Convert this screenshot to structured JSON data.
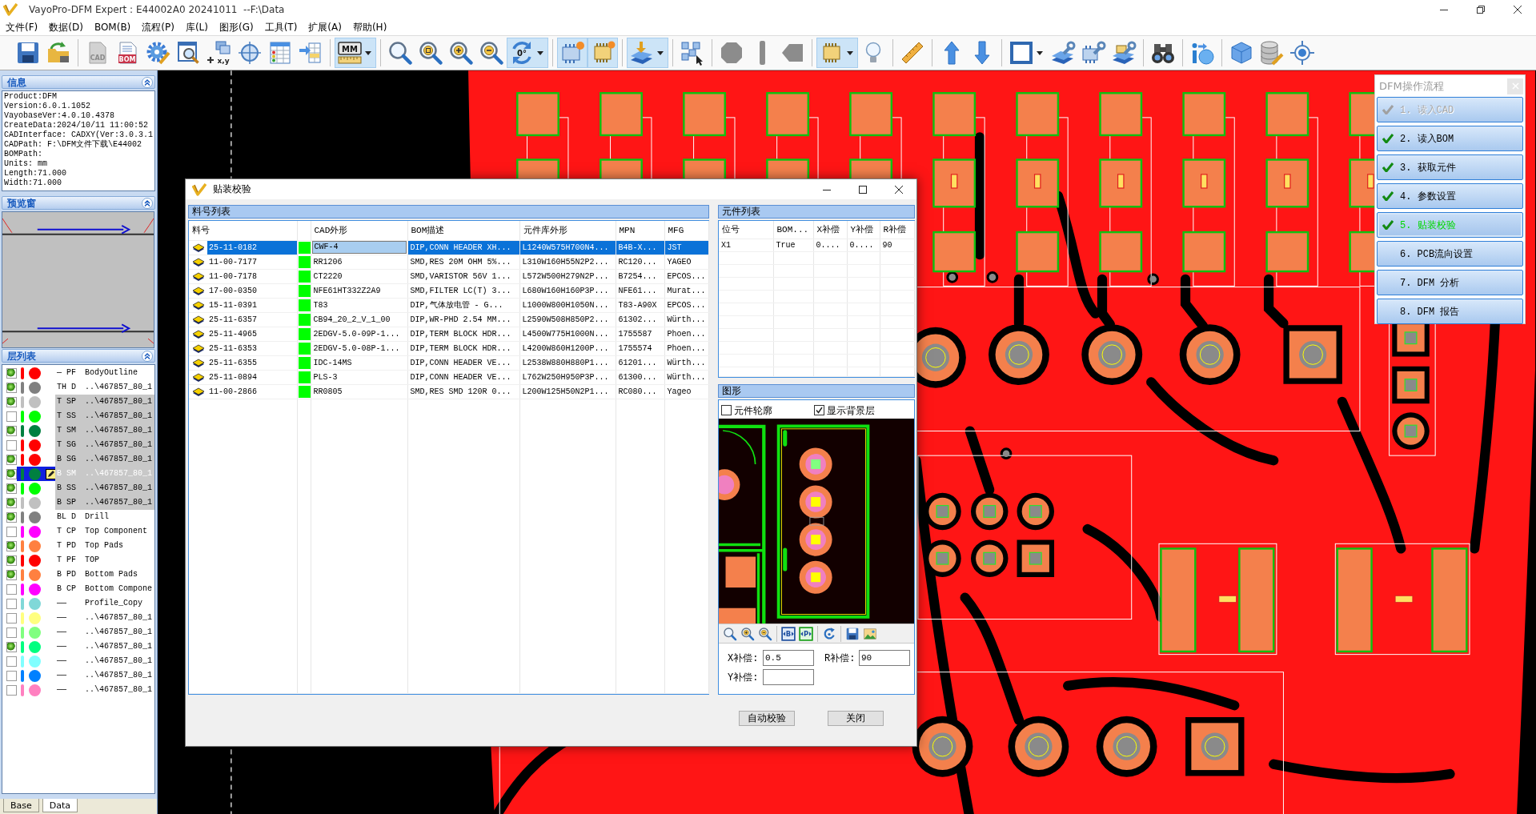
{
  "window": {
    "title": "VayoPro-DFM Expert : E44002A0 20241011  --F:\\Data"
  },
  "menu": [
    "文件(F)",
    "数据(D)",
    "BOM(B)",
    "流程(P)",
    "库(L)",
    "图形(G)",
    "工具(T)",
    "扩展(A)",
    "帮助(H)"
  ],
  "toolbar": [
    [
      {
        "kind": "save",
        "pressed": false
      },
      {
        "kind": "reload",
        "pressed": false
      }
    ],
    [
      {
        "kind": "cad",
        "label": "CAD",
        "pressed": false
      },
      {
        "kind": "bom",
        "label": "BOM",
        "pressed": false
      },
      {
        "kind": "gear",
        "pressed": false
      },
      {
        "kind": "find",
        "pressed": false
      },
      {
        "kind": "xy",
        "label": "x,y",
        "pressed": false
      },
      {
        "kind": "target",
        "pressed": false
      },
      {
        "kind": "table",
        "pressed": false
      },
      {
        "kind": "import",
        "pressed": false
      }
    ],
    [
      {
        "kind": "units",
        "label": "MM",
        "pressed": true,
        "dropdown": true
      }
    ],
    [
      {
        "kind": "zoom",
        "pressed": false
      },
      {
        "kind": "zoom-fit",
        "pressed": false
      },
      {
        "kind": "zoom-in",
        "pressed": false
      },
      {
        "kind": "zoom-out",
        "pressed": false
      },
      {
        "kind": "rotate",
        "label": "0°",
        "pressed": true,
        "dropdown": true
      }
    ],
    [
      {
        "kind": "component",
        "pressed": true
      },
      {
        "kind": "component-alt",
        "pressed": true
      }
    ],
    [
      {
        "kind": "layers",
        "pressed": true,
        "dropdown": true
      }
    ],
    [
      {
        "kind": "select",
        "pressed": false
      }
    ],
    [
      {
        "kind": "octagon",
        "pressed": false
      },
      {
        "kind": "bar",
        "pressed": false
      },
      {
        "kind": "notch",
        "pressed": false
      }
    ],
    [
      {
        "kind": "chip",
        "pressed": true,
        "dropdown": true
      },
      {
        "kind": "bulb",
        "pressed": false
      }
    ],
    [
      {
        "kind": "ruler",
        "pressed": false
      }
    ],
    [
      {
        "kind": "up",
        "pressed": false
      },
      {
        "kind": "down",
        "pressed": false
      }
    ],
    [
      {
        "kind": "square",
        "pressed": false,
        "dropdown": true
      },
      {
        "kind": "tool-layers",
        "pressed": false
      },
      {
        "kind": "tool-chip",
        "pressed": false
      },
      {
        "kind": "tool-both",
        "pressed": false
      }
    ],
    [
      {
        "kind": "binoculars",
        "pressed": false
      }
    ],
    [
      {
        "kind": "info",
        "pressed": false
      }
    ],
    [
      {
        "kind": "box",
        "pressed": false
      },
      {
        "kind": "database",
        "pressed": false
      },
      {
        "kind": "crosshair",
        "pressed": false
      }
    ]
  ],
  "info_panel": {
    "title": "信息",
    "lines": [
      "Product:DFM",
      "Version:6.0.1.1052",
      "VayobaseVer:4.0.10.4378",
      "CreateData:2024/10/11 11:00:52",
      "CADInterface: CADXY(Ver:3.0.3.1",
      "CADPath: F:\\DFM文件下载\\E44002",
      "BOMPath:",
      "Units: mm",
      "Length:71.000",
      "Width:71.000"
    ]
  },
  "preview_panel": {
    "title": "预览窗"
  },
  "layer_panel": {
    "title": "层列表",
    "layers": [
      {
        "checked": true,
        "color": "#ff0000",
        "code": "— PF",
        "name": "BodyOutline",
        "highlighted": false,
        "selected": false
      },
      {
        "checked": true,
        "color": "#808080",
        "code": "TH D",
        "name": "..\\467857_80_1",
        "highlighted": false,
        "selected": false
      },
      {
        "checked": true,
        "color": "#c0c0c0",
        "code": "T SP",
        "name": "..\\467857_80_1",
        "highlighted": true,
        "selected": false
      },
      {
        "checked": false,
        "color": "#00ff00",
        "code": "T SS",
        "name": "..\\467857_80_1",
        "highlighted": true,
        "selected": false
      },
      {
        "checked": true,
        "color": "#008040",
        "code": "T SM",
        "name": "..\\467857_80_1",
        "highlighted": true,
        "selected": false
      },
      {
        "checked": false,
        "color": "#ff0000",
        "code": "T SG",
        "name": "..\\467857_80_1",
        "highlighted": true,
        "selected": false
      },
      {
        "checked": true,
        "color": "#ff0000",
        "code": "B SG",
        "name": "..\\467857_80_1",
        "highlighted": true,
        "selected": false
      },
      {
        "checked": true,
        "color": "#008040",
        "code": "B SM",
        "name": "..\\467857_80_1",
        "highlighted": true,
        "selected": true
      },
      {
        "checked": true,
        "color": "#00ff00",
        "code": "B SS",
        "name": "..\\467857_80_1",
        "highlighted": true,
        "selected": false
      },
      {
        "checked": true,
        "color": "#c0c0c0",
        "code": "B SP",
        "name": "..\\467857_80_1",
        "highlighted": true,
        "selected": false
      },
      {
        "checked": true,
        "color": "#808080",
        "code": "BL D",
        "name": "Drill",
        "highlighted": false,
        "selected": false
      },
      {
        "checked": false,
        "color": "#ff00ff",
        "code": "T CP",
        "name": "Top Component",
        "highlighted": false,
        "selected": false
      },
      {
        "checked": true,
        "color": "#ff8040",
        "code": "T PD",
        "name": "Top Pads",
        "highlighted": false,
        "selected": false
      },
      {
        "checked": true,
        "color": "#ff0000",
        "code": "T PF",
        "name": "TOP",
        "highlighted": false,
        "selected": false
      },
      {
        "checked": true,
        "color": "#ff8040",
        "code": "B PD",
        "name": "Bottom Pads",
        "highlighted": false,
        "selected": false
      },
      {
        "checked": false,
        "color": "#ff00ff",
        "code": "B CP",
        "name": "Bottom Compone",
        "highlighted": false,
        "selected": false
      },
      {
        "checked": false,
        "color": "#80d8d8",
        "code": "——",
        "name": "Profile_Copy",
        "highlighted": false,
        "selected": false
      },
      {
        "checked": false,
        "color": "#ffff80",
        "code": "——",
        "name": "..\\467857_80_1",
        "highlighted": false,
        "selected": false
      },
      {
        "checked": false,
        "color": "#80ff80",
        "code": "——",
        "name": "..\\467857_80_1",
        "highlighted": false,
        "selected": false
      },
      {
        "checked": true,
        "color": "#00ff80",
        "code": "——",
        "name": "..\\467857_80_1",
        "highlighted": false,
        "selected": false
      },
      {
        "checked": false,
        "color": "#80ffff",
        "code": "——",
        "name": "..\\467857_80_1",
        "highlighted": false,
        "selected": false
      },
      {
        "checked": false,
        "color": "#0080ff",
        "code": "——",
        "name": "..\\467857_80_1",
        "highlighted": false,
        "selected": false
      },
      {
        "checked": false,
        "color": "#ff80c0",
        "code": "——",
        "name": "..\\467857_80_1",
        "highlighted": false,
        "selected": false
      }
    ]
  },
  "panel_tabs": [
    {
      "label": "Base",
      "selected": false
    },
    {
      "label": "Data",
      "selected": true
    }
  ],
  "dialog": {
    "title": "贴装校验",
    "parts": {
      "title": "料号列表",
      "columns": [
        "料号",
        "CAD外形",
        "BOM描述",
        "元件库外形",
        "MPN",
        "MFG"
      ],
      "rows": [
        {
          "part_no": "25-11-0182",
          "matched": true,
          "cad_shape": "CWF-4",
          "bom_desc": "DIP,CONN HEADER XH...",
          "lib_shape": "L1240W575H700N4...",
          "mpn": "B4B-X...",
          "mfg": "JST",
          "selected": true,
          "editing": true
        },
        {
          "part_no": "11-00-7177",
          "matched": true,
          "cad_shape": "RR1206",
          "bom_desc": "SMD,RES 20M OHM 5%...",
          "lib_shape": "L310W160H55N2P2...",
          "mpn": "RC120...",
          "mfg": "YAGEO",
          "selected": false,
          "editing": false
        },
        {
          "part_no": "11-00-7178",
          "matched": true,
          "cad_shape": "CT2220",
          "bom_desc": "SMD,VARISTOR 56V 1...",
          "lib_shape": "L572W500H279N2P...",
          "mpn": "B7254...",
          "mfg": "EPCOS...",
          "selected": false,
          "editing": false
        },
        {
          "part_no": "17-00-0350",
          "matched": true,
          "cad_shape": "NFE61HT332Z2A9",
          "bom_desc": "SMD,FILTER LC(T) 3...",
          "lib_shape": "L680W160H160P3P...",
          "mpn": "NFE61...",
          "mfg": "Murat...",
          "selected": false,
          "editing": false
        },
        {
          "part_no": "15-11-0391",
          "matched": true,
          "cad_shape": "T83",
          "bom_desc": "DIP,气体放电管 - G...",
          "lib_shape": "L1000W800H1050N...",
          "mpn": "T83-A90X",
          "mfg": "EPCOS...",
          "selected": false,
          "editing": false
        },
        {
          "part_no": "25-11-6357",
          "matched": true,
          "cad_shape": "CB94_20_2_V_1_00",
          "bom_desc": "DIP,WR-PHD 2.54 MM...",
          "lib_shape": "L2590W508H850P2...",
          "mpn": "61302...",
          "mfg": "Würth...",
          "selected": false,
          "editing": false
        },
        {
          "part_no": "25-11-4965",
          "matched": true,
          "cad_shape": "2EDGV-5.0-09P-1...",
          "bom_desc": "DIP,TERM BLOCK HDR...",
          "lib_shape": "L4500W775H1000N...",
          "mpn": "1755587",
          "mfg": "Phoen...",
          "selected": false,
          "editing": false
        },
        {
          "part_no": "25-11-6353",
          "matched": true,
          "cad_shape": "2EDGV-5.0-08P-1...",
          "bom_desc": "DIP,TERM BLOCK HDR...",
          "lib_shape": "L4200W860H1200P...",
          "mpn": "1755574",
          "mfg": "Phoen...",
          "selected": false,
          "editing": false
        },
        {
          "part_no": "25-11-6355",
          "matched": true,
          "cad_shape": "IDC-14MS",
          "bom_desc": "DIP,CONN HEADER VE...",
          "lib_shape": "L2538W880H880P1...",
          "mpn": "61201...",
          "mfg": "Würth...",
          "selected": false,
          "editing": false
        },
        {
          "part_no": "25-11-0894",
          "matched": true,
          "cad_shape": "PLS-3",
          "bom_desc": "DIP,CONN HEADER VE...",
          "lib_shape": "L762W250H950P3P...",
          "mpn": "61300...",
          "mfg": "Würth...",
          "selected": false,
          "editing": false
        },
        {
          "part_no": "11-00-2866",
          "matched": true,
          "cad_shape": "RR0805",
          "bom_desc": "SMD,RES SMD 120R 0...",
          "lib_shape": "L200W125H50N2P1...",
          "mpn": "RC080...",
          "mfg": "Yageo",
          "selected": false,
          "editing": false
        }
      ]
    },
    "components": {
      "title": "元件列表",
      "columns": [
        "位号",
        "BOM...",
        "X补偿",
        "Y补偿",
        "R补偿"
      ],
      "rows": [
        [
          "X1",
          "True",
          "0....",
          "0....",
          "90"
        ]
      ]
    },
    "graphics": {
      "title": "图形",
      "options": [
        {
          "label": "元件轮廓",
          "checked": false
        },
        {
          "label": "显示背景层",
          "checked": true
        }
      ],
      "tools": [
        [
          {
            "kind": "zoom"
          },
          {
            "kind": "zoom-in"
          },
          {
            "kind": "zoom-out"
          }
        ],
        [
          {
            "kind": "fit-board",
            "label": "B"
          },
          {
            "kind": "fit-part",
            "label": "P"
          }
        ],
        [
          {
            "kind": "refresh"
          }
        ],
        [
          {
            "kind": "save"
          },
          {
            "kind": "image"
          }
        ]
      ],
      "fields": [
        {
          "label": "X补偿:",
          "value": "0.5"
        },
        {
          "label": "R补偿:",
          "value": "90"
        },
        {
          "label": "Y补偿:"
        }
      ]
    },
    "buttons": [
      "自动校验",
      "关闭"
    ]
  },
  "flow_panel": {
    "title": "DFM操作流程",
    "steps": [
      {
        "label": "1. 读入CAD",
        "done": true,
        "disabled": true,
        "selected": false
      },
      {
        "label": "2. 读入BOM",
        "done": true,
        "disabled": false,
        "selected": false
      },
      {
        "label": "3. 获取元件",
        "done": true,
        "disabled": false,
        "selected": false
      },
      {
        "label": "4. 参数设置",
        "done": true,
        "disabled": false,
        "selected": false
      },
      {
        "label": "5. 贴装校验",
        "done": true,
        "disabled": false,
        "selected": true
      },
      {
        "label": "6. PCB流向设置",
        "done": false,
        "disabled": false,
        "selected": false
      },
      {
        "label": "7. DFM 分析",
        "done": false,
        "disabled": false,
        "selected": false
      },
      {
        "label": "8. DFM 报告",
        "done": false,
        "disabled": false,
        "selected": false
      }
    ]
  }
}
